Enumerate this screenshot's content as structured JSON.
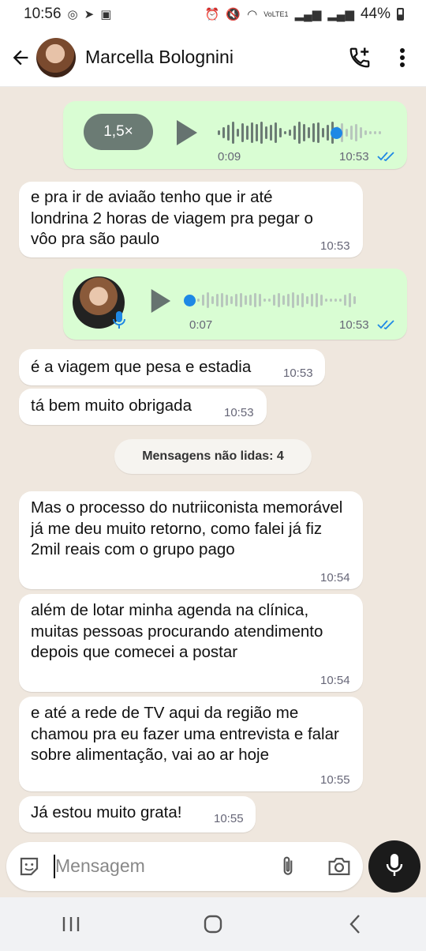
{
  "status": {
    "time": "10:56",
    "network_label": "VoLTE1",
    "battery": "44%"
  },
  "header": {
    "contact_name": "Marcella Bolognini"
  },
  "messages": [
    {
      "type": "audio",
      "direction": "out",
      "speed": "1,5×",
      "duration": "0:09",
      "time": "10:53",
      "read": true,
      "progress": 0.7
    },
    {
      "type": "text",
      "direction": "in",
      "text": "e pra ir de aviaão tenho que ir até londrina 2 horas de viagem pra pegar o vôo pra são paulo",
      "time": "10:53"
    },
    {
      "type": "audio",
      "direction": "out",
      "duration": "0:07",
      "time": "10:53",
      "read": true,
      "progress": 0.0
    },
    {
      "type": "text",
      "direction": "in",
      "text": "é a viagem que pesa e estadia",
      "time": "10:53"
    },
    {
      "type": "text",
      "direction": "in",
      "text": "tá bem muito obrigada",
      "time": "10:53"
    },
    {
      "type": "text",
      "direction": "in",
      "text": "Mas o processo do nutriiconista memorável já me deu muito retorno, como falei já fiz 2mil reais com o grupo pago",
      "time": "10:54"
    },
    {
      "type": "text",
      "direction": "in",
      "text": "além de lotar minha agenda na clínica, muitas pessoas procurando atendimento depois que comecei a postar",
      "time": "10:54"
    },
    {
      "type": "text",
      "direction": "in",
      "text": "e até a rede de TV aqui da região me chamou pra eu fazer uma entrevista e falar sobre alimentação, vai ao ar hoje",
      "time": "10:55"
    },
    {
      "type": "text",
      "direction": "in",
      "text": "Já estou muito grata!",
      "time": "10:55"
    }
  ],
  "unread_banner": "Mensagens não lidas: 4",
  "composer": {
    "placeholder": "Mensagem"
  },
  "colors": {
    "incoming": "#ffffff",
    "outgoing": "#d9fdd3",
    "chat_background": "#efe7de",
    "accent_blue": "#1e88e5",
    "speed_pill": "#6b7b74"
  },
  "icons": [
    "back-arrow-icon",
    "add-call-icon",
    "more-vert-icon",
    "play-icon",
    "mic-icon",
    "double-check-icon",
    "sticker-icon",
    "attach-icon",
    "camera-icon",
    "recents-icon",
    "home-icon",
    "back-icon"
  ]
}
